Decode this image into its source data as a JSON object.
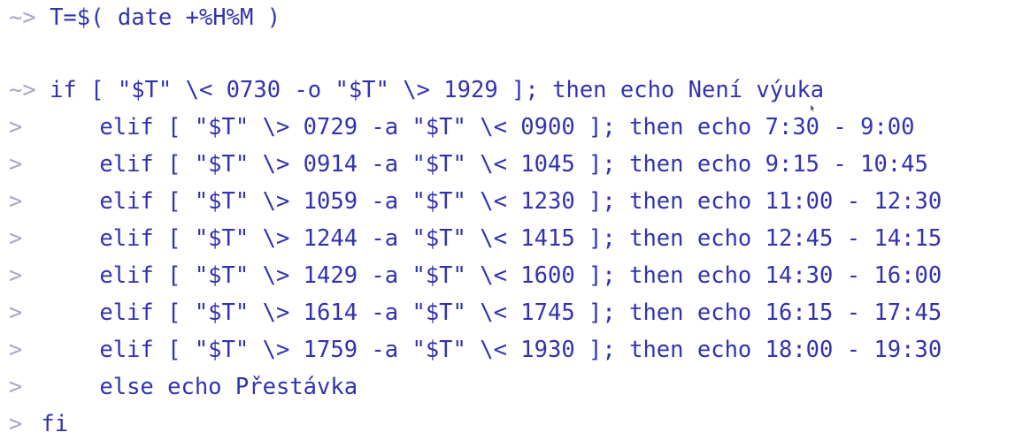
{
  "terminal": {
    "lines": [
      {
        "prompt": "~>",
        "command": "T=$( date +%H%M )"
      },
      {
        "prompt": "~>",
        "command": "if [ \"$T\" \\< 0730 -o \"$T\" \\> 1929 ]; then echo Není výuka"
      },
      {
        "prompt": ">",
        "command": "elif [ \"$T\" \\> 0729 -a \"$T\" \\< 0900 ]; then echo 7:30 - 9:00"
      },
      {
        "prompt": ">",
        "command": "elif [ \"$T\" \\> 0914 -a \"$T\" \\< 1045 ]; then echo 9:15 - 10:45"
      },
      {
        "prompt": ">",
        "command": "elif [ \"$T\" \\> 1059 -a \"$T\" \\< 1230 ]; then echo 11:00 - 12:30"
      },
      {
        "prompt": ">",
        "command": "elif [ \"$T\" \\> 1244 -a \"$T\" \\< 1415 ]; then echo 12:45 - 14:15"
      },
      {
        "prompt": ">",
        "command": "elif [ \"$T\" \\> 1429 -a \"$T\" \\< 1600 ]; then echo 14:30 - 16:00"
      },
      {
        "prompt": ">",
        "command": "elif [ \"$T\" \\> 1614 -a \"$T\" \\< 1745 ]; then echo 16:15 - 17:45"
      },
      {
        "prompt": ">",
        "command": "elif [ \"$T\" \\> 1759 -a \"$T\" \\< 1930 ]; then echo 18:00 - 19:30"
      },
      {
        "prompt": ">",
        "command": "else echo Přestávka"
      },
      {
        "prompt": ">",
        "command": "fi"
      }
    ]
  },
  "colors": {
    "command": "#3232b0",
    "prompt": "#a8a8c4",
    "background": "#ffffff"
  },
  "icons": {
    "cursor": "mouse-pointer-icon"
  }
}
